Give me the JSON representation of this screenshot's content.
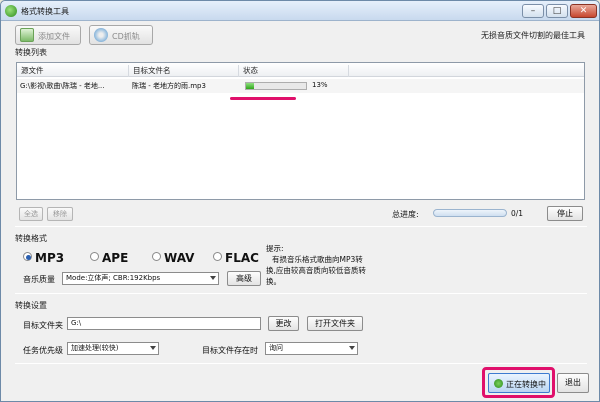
{
  "window": {
    "title": "格式转换工具"
  },
  "toolbar": {
    "add_file": "添加文件",
    "cd_rip": "CD抓轨",
    "tagline": "无损音质文件切割的最佳工具"
  },
  "list": {
    "section_title": "转换列表",
    "columns": [
      "源文件",
      "目标文件名",
      "状态"
    ],
    "rows": [
      {
        "source": "G:\\影视\\歌曲\\陈瑞 - 老地...",
        "target": "陈瑞 - 老地方的雨.mp3",
        "progress": 0.13,
        "progress_text": "13%"
      }
    ],
    "select_all": "全选",
    "remove": "移除"
  },
  "total": {
    "label": "总进度:",
    "count": "0/1",
    "stop": "停止"
  },
  "format": {
    "section_title": "转换格式",
    "options": [
      "MP3",
      "APE",
      "WAV",
      "FLAC"
    ],
    "selected": "MP3",
    "quality_label": "音乐质量",
    "quality_value": "Mode:立体声; CBR:192Kbps",
    "advanced": "高级",
    "hint_title": "提示:",
    "hint_body": "有损音乐格式歌曲向MP3转换,应由较高音质向较低音质转换。"
  },
  "settings": {
    "section_title": "转换设置",
    "target_folder_label": "目标文件夹",
    "target_folder_value": "G:\\",
    "change": "更改",
    "open_folder": "打开文件夹",
    "priority_label": "任务优先级",
    "priority_value": "加速处理(较快)",
    "exists_label": "目标文件存在时",
    "exists_value": "询问"
  },
  "actions": {
    "start": "正在转换中",
    "exit": "退出"
  },
  "colors": {
    "annotation": "#e0106b",
    "progress_fill": "#2fa51a"
  }
}
